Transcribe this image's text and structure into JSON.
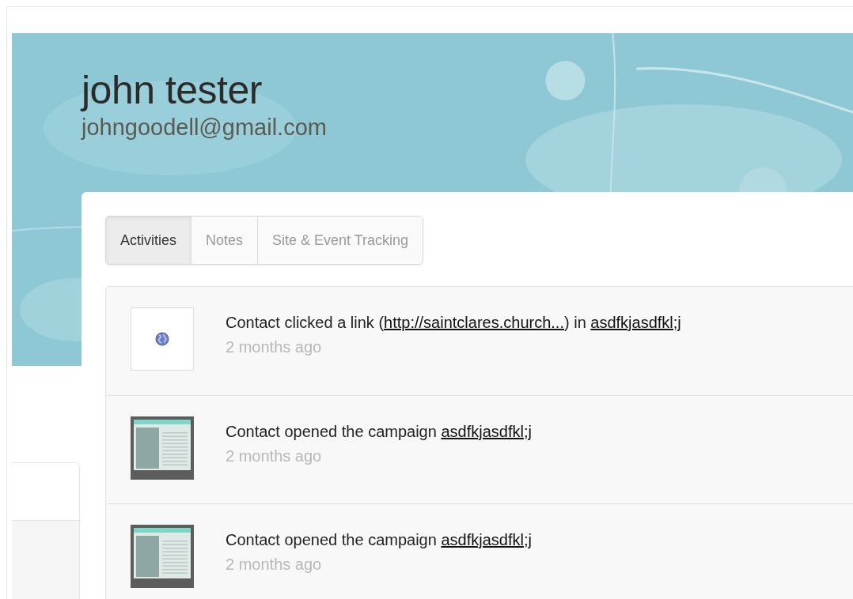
{
  "contact": {
    "name": "john tester",
    "email": "johngoodell@gmail.com"
  },
  "tabs": [
    {
      "label": "Activities",
      "selected": true
    },
    {
      "label": "Notes",
      "selected": false
    },
    {
      "label": "Site & Event Tracking",
      "selected": false
    }
  ],
  "activities": [
    {
      "kind": "link",
      "segments": [
        {
          "kind": "text",
          "text": "Contact clicked a link ("
        },
        {
          "kind": "link",
          "text": "http://saintclares.church..."
        },
        {
          "kind": "text",
          "text": ") in "
        },
        {
          "kind": "link",
          "text": "asdfkjasdfkl;j"
        }
      ],
      "time": "2 months ago"
    },
    {
      "kind": "open",
      "segments": [
        {
          "kind": "text",
          "text": "Contact opened the campaign "
        },
        {
          "kind": "link",
          "text": "asdfkjasdfkl;j"
        }
      ],
      "time": "2 months ago"
    },
    {
      "kind": "open",
      "segments": [
        {
          "kind": "text",
          "text": "Contact opened the campaign "
        },
        {
          "kind": "link",
          "text": "asdfkjasdfkl;j"
        }
      ],
      "time": "2 months ago"
    }
  ]
}
